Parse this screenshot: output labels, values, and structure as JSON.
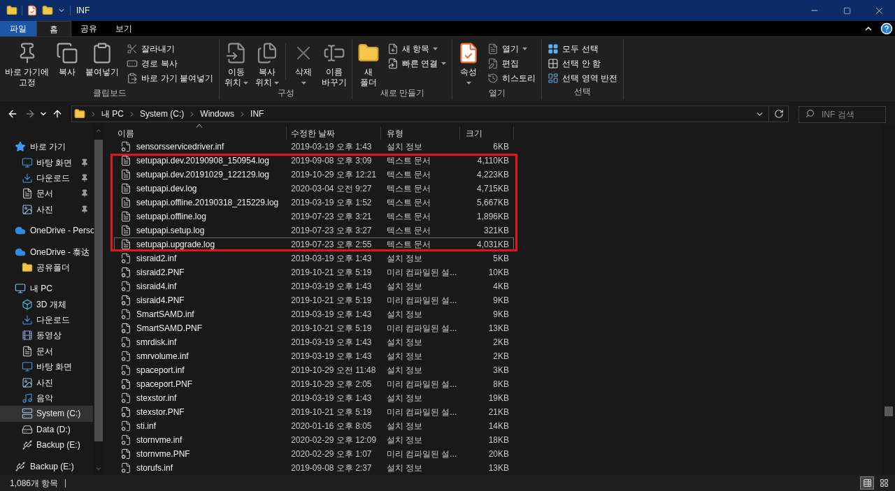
{
  "title_bar": {
    "title": "INF"
  },
  "ribbon": {
    "tabs": [
      {
        "label": "파일",
        "kind": "file",
        "selected": false
      },
      {
        "label": "홈",
        "kind": "tab",
        "selected": true
      },
      {
        "label": "공유",
        "kind": "tab",
        "selected": false
      },
      {
        "label": "보기",
        "kind": "tab",
        "selected": false
      }
    ],
    "groups": [
      {
        "label": "클립보드",
        "columns": [
          {
            "kind": "large",
            "label": "바로 가기에\n고정"
          },
          {
            "kind": "large",
            "label": "복사"
          },
          {
            "kind": "large",
            "label": "붙여넣기"
          },
          {
            "kind": "stack",
            "items": [
              {
                "label": "잘라내기"
              },
              {
                "label": "경로 복사"
              },
              {
                "label": "바로 가기 붙여넣기"
              }
            ]
          }
        ]
      },
      {
        "label": "구성",
        "columns": [
          {
            "kind": "large",
            "label": "이동\n위치",
            "dropdown": true
          },
          {
            "kind": "large",
            "label": "복사\n위치",
            "dropdown": true
          },
          {
            "kind": "divider"
          },
          {
            "kind": "large",
            "label": "삭제",
            "dropdown": true
          },
          {
            "kind": "large",
            "label": "이름\n바꾸기"
          }
        ]
      },
      {
        "label": "새로 만들기",
        "columns": [
          {
            "kind": "large",
            "label": "새\n폴더"
          },
          {
            "kind": "stack",
            "items": [
              {
                "label": "새 항목",
                "dropdown": true
              },
              {
                "label": "빠른 연결",
                "dropdown": true
              }
            ]
          }
        ]
      },
      {
        "label": "열기",
        "columns": [
          {
            "kind": "large",
            "label": "속성",
            "dropdown": true
          },
          {
            "kind": "stack",
            "items": [
              {
                "label": "열기",
                "dropdown": true
              },
              {
                "label": "편집"
              },
              {
                "label": "히스토리"
              }
            ]
          }
        ]
      },
      {
        "label": "선택",
        "columns": [
          {
            "kind": "stack",
            "items": [
              {
                "label": "모두 선택"
              },
              {
                "label": "선택 안 함"
              },
              {
                "label": "선택 영역 반전"
              }
            ]
          }
        ]
      }
    ]
  },
  "address": {
    "crumbs": [
      "내 PC",
      "System (C:)",
      "Windows",
      "INF"
    ]
  },
  "search": {
    "placeholder": "INF 검색"
  },
  "navigation": {
    "items": [
      {
        "label": "바로 가기",
        "selected": false,
        "children": [
          {
            "label": "바탕 화면",
            "pinned": true,
            "selected": false
          },
          {
            "label": "다운로드",
            "pinned": true,
            "selected": false
          },
          {
            "label": "문서",
            "pinned": true,
            "selected": false
          },
          {
            "label": "사진",
            "pinned": true,
            "selected": false
          }
        ]
      },
      {
        "label": "OneDrive - Perso",
        "selected": false
      },
      {
        "label": "OneDrive - 泰达",
        "selected": false,
        "children": [
          {
            "label": "공유폴더",
            "selected": false
          }
        ]
      },
      {
        "label": "내 PC",
        "selected": false,
        "children": [
          {
            "label": "3D 개체",
            "selected": false
          },
          {
            "label": "다운로드",
            "selected": false
          },
          {
            "label": "동영상",
            "selected": false
          },
          {
            "label": "문서",
            "selected": false
          },
          {
            "label": "바탕 화면",
            "selected": false
          },
          {
            "label": "사진",
            "selected": false
          },
          {
            "label": "음악",
            "selected": false
          },
          {
            "label": "System (C:)",
            "selected": true
          },
          {
            "label": "Data (D:)",
            "selected": false
          },
          {
            "label": "Backup (E:)",
            "selected": false
          }
        ]
      },
      {
        "label": "Backup (E:)",
        "selected": false
      }
    ]
  },
  "file_list": {
    "columns": [
      {
        "label": "이름",
        "sorted": true
      },
      {
        "label": "수정한 날짜",
        "sorted": false
      },
      {
        "label": "유형",
        "sorted": false
      },
      {
        "label": "크기",
        "sorted": false
      }
    ],
    "rows": [
      {
        "name": "sensorsservicedriver.inf",
        "date": "2019-03-19 오후 1:43",
        "type": "설치 정보",
        "size": "6KB",
        "kind": "inf",
        "highlighted": false,
        "focused": false
      },
      {
        "name": "setupapi.dev.20190908_150954.log",
        "date": "2019-09-08 오후 3:09",
        "type": "텍스트 문서",
        "size": "4,110KB",
        "kind": "log",
        "highlighted": true,
        "focused": false
      },
      {
        "name": "setupapi.dev.20191029_122129.log",
        "date": "2019-10-29 오후 12:21",
        "type": "텍스트 문서",
        "size": "4,223KB",
        "kind": "log",
        "highlighted": true,
        "focused": false
      },
      {
        "name": "setupapi.dev.log",
        "date": "2020-03-04 오전 9:27",
        "type": "텍스트 문서",
        "size": "4,715KB",
        "kind": "log",
        "highlighted": true,
        "focused": false
      },
      {
        "name": "setupapi.offline.20190318_215229.log",
        "date": "2019-03-19 오후 1:52",
        "type": "텍스트 문서",
        "size": "5,667KB",
        "kind": "log",
        "highlighted": true,
        "focused": false
      },
      {
        "name": "setupapi.offline.log",
        "date": "2019-07-23 오후 3:21",
        "type": "텍스트 문서",
        "size": "1,896KB",
        "kind": "log",
        "highlighted": true,
        "focused": false
      },
      {
        "name": "setupapi.setup.log",
        "date": "2019-07-23 오후 3:27",
        "type": "텍스트 문서",
        "size": "321KB",
        "kind": "log",
        "highlighted": true,
        "focused": false
      },
      {
        "name": "setupapi.upgrade.log",
        "date": "2019-07-23 오후 2:55",
        "type": "텍스트 문서",
        "size": "4,031KB",
        "kind": "log",
        "highlighted": true,
        "focused": true
      },
      {
        "name": "sisraid2.inf",
        "date": "2019-03-19 오후 1:43",
        "type": "설치 정보",
        "size": "5KB",
        "kind": "inf",
        "highlighted": false,
        "focused": false
      },
      {
        "name": "sisraid2.PNF",
        "date": "2019-10-21 오후 5:19",
        "type": "미리 컴파일된 설...",
        "size": "10KB",
        "kind": "pnf",
        "highlighted": false,
        "focused": false
      },
      {
        "name": "sisraid4.inf",
        "date": "2019-03-19 오후 1:43",
        "type": "설치 정보",
        "size": "4KB",
        "kind": "inf",
        "highlighted": false,
        "focused": false
      },
      {
        "name": "sisraid4.PNF",
        "date": "2019-10-21 오후 5:19",
        "type": "미리 컴파일된 설...",
        "size": "9KB",
        "kind": "pnf",
        "highlighted": false,
        "focused": false
      },
      {
        "name": "SmartSAMD.inf",
        "date": "2019-03-19 오후 1:43",
        "type": "설치 정보",
        "size": "9KB",
        "kind": "inf",
        "highlighted": false,
        "focused": false
      },
      {
        "name": "SmartSAMD.PNF",
        "date": "2019-10-21 오후 5:19",
        "type": "미리 컴파일된 설...",
        "size": "13KB",
        "kind": "pnf",
        "highlighted": false,
        "focused": false
      },
      {
        "name": "smrdisk.inf",
        "date": "2019-03-19 오후 1:43",
        "type": "설치 정보",
        "size": "2KB",
        "kind": "inf",
        "highlighted": false,
        "focused": false
      },
      {
        "name": "smrvolume.inf",
        "date": "2019-03-19 오후 1:43",
        "type": "설치 정보",
        "size": "2KB",
        "kind": "inf",
        "highlighted": false,
        "focused": false
      },
      {
        "name": "spaceport.inf",
        "date": "2019-10-29 오전 11:48",
        "type": "설치 정보",
        "size": "3KB",
        "kind": "inf",
        "highlighted": false,
        "focused": false
      },
      {
        "name": "spaceport.PNF",
        "date": "2019-10-29 오후 2:05",
        "type": "미리 컴파일된 설...",
        "size": "8KB",
        "kind": "pnf",
        "highlighted": false,
        "focused": false
      },
      {
        "name": "stexstor.inf",
        "date": "2019-03-19 오후 1:43",
        "type": "설치 정보",
        "size": "19KB",
        "kind": "inf",
        "highlighted": false,
        "focused": false
      },
      {
        "name": "stexstor.PNF",
        "date": "2019-10-21 오후 5:19",
        "type": "미리 컴파일된 설...",
        "size": "21KB",
        "kind": "pnf",
        "highlighted": false,
        "focused": false
      },
      {
        "name": "sti.inf",
        "date": "2020-01-16 오후 8:05",
        "type": "설치 정보",
        "size": "14KB",
        "kind": "inf",
        "highlighted": false,
        "focused": false
      },
      {
        "name": "stornvme.inf",
        "date": "2020-02-29 오후 12:09",
        "type": "설치 정보",
        "size": "18KB",
        "kind": "inf",
        "highlighted": false,
        "focused": false
      },
      {
        "name": "stornvme.PNF",
        "date": "2020-02-29 오후 1:07",
        "type": "미리 컴파일된 설...",
        "size": "20KB",
        "kind": "pnf",
        "highlighted": false,
        "focused": false
      },
      {
        "name": "storufs.inf",
        "date": "2019-09-08 오후 2:37",
        "type": "설치 정보",
        "size": "13KB",
        "kind": "inf",
        "highlighted": false,
        "focused": false
      }
    ]
  },
  "status_bar": {
    "item_count": "1,086개 항목",
    "views": [
      {
        "kind": "details",
        "selected": true
      },
      {
        "kind": "large-icons",
        "selected": false
      }
    ]
  }
}
